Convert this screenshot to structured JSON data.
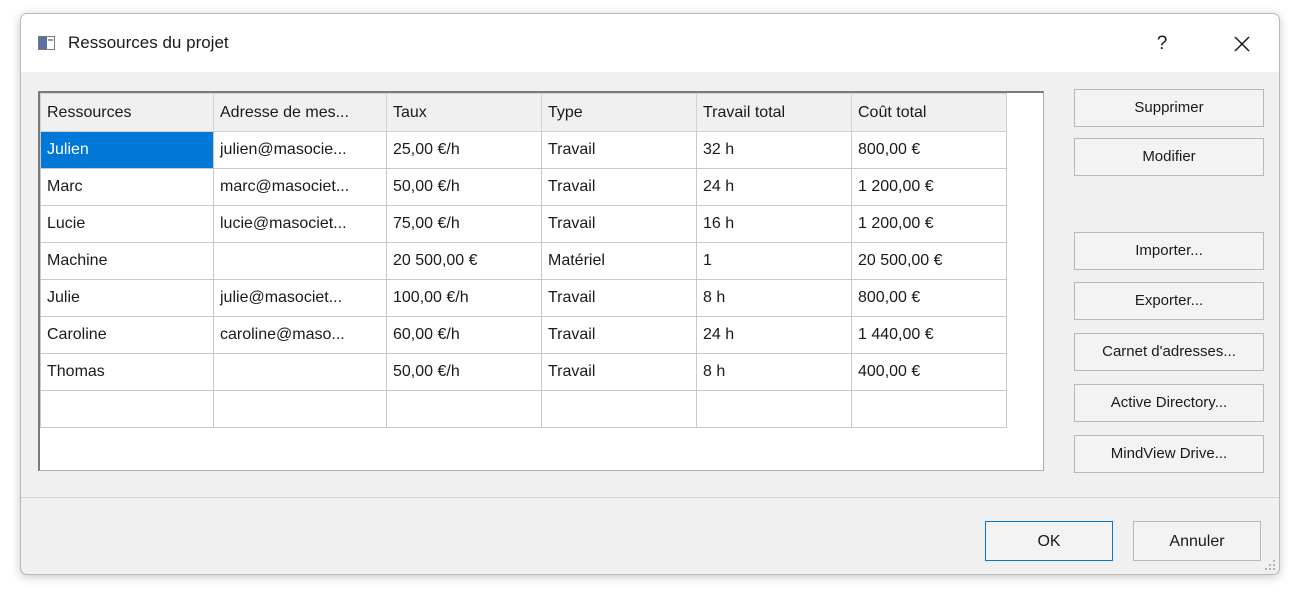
{
  "window": {
    "title": "Ressources du projet",
    "help": "?",
    "icons": {
      "app": "window-icon",
      "close": "close-icon",
      "resize": "resize-grip-icon"
    }
  },
  "table": {
    "columns": [
      "Ressources",
      "Adresse de mes...",
      "Taux",
      "Type",
      "Travail total",
      "Coût total"
    ],
    "rows": [
      [
        "Julien",
        "julien@masocie...",
        "25,00 €/h",
        "Travail",
        "32 h",
        "800,00 €"
      ],
      [
        "Marc",
        "marc@masociet...",
        "50,00 €/h",
        "Travail",
        "24 h",
        "1 200,00 €"
      ],
      [
        "Lucie",
        "lucie@masociet...",
        "75,00 €/h",
        "Travail",
        "16 h",
        "1 200,00 €"
      ],
      [
        "Machine",
        "",
        "20 500,00 €",
        "Matériel",
        "1",
        "20 500,00 €"
      ],
      [
        "Julie",
        "julie@masociet...",
        "100,00 €/h",
        "Travail",
        "8 h",
        "800,00 €"
      ],
      [
        "Caroline",
        "caroline@maso...",
        "60,00 €/h",
        "Travail",
        "24 h",
        "1 440,00 €"
      ],
      [
        "Thomas",
        "",
        "50,00 €/h",
        "Travail",
        "8 h",
        "400,00 €"
      ],
      [
        "",
        "",
        "",
        "",
        "",
        ""
      ]
    ],
    "selected": "Julien"
  },
  "buttons": {
    "delete": "Supprimer",
    "edit": "Modifier",
    "import": "Importer...",
    "export": "Exporter...",
    "address_book": "Carnet d'adresses...",
    "active_directory": "Active Directory...",
    "mindview_drive": "MindView Drive...",
    "ok": "OK",
    "cancel": "Annuler"
  },
  "colors": {
    "selection": "#0078d7",
    "dialog_bg": "#f0f0f0",
    "default_border": "#0078d7"
  }
}
